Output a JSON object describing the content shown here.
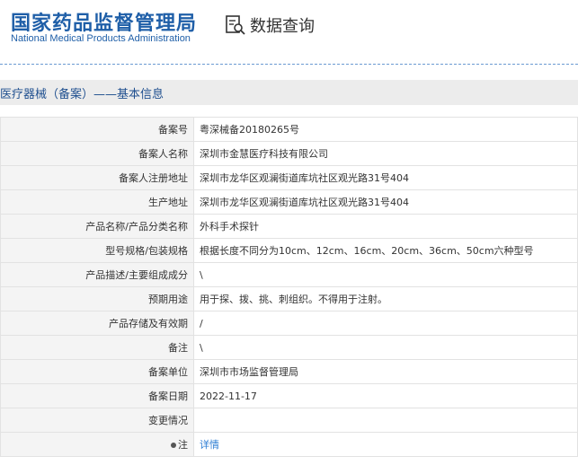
{
  "header": {
    "logo_cn": "国家药品监督管理局",
    "logo_en": "National Medical Products Administration",
    "search_label": "数据查询"
  },
  "section": {
    "title": "医疗器械（备案）——基本信息"
  },
  "rows": [
    {
      "label": "备案号",
      "value": "粤深械备20180265号"
    },
    {
      "label": "备案人名称",
      "value": "深圳市金慧医疗科技有限公司"
    },
    {
      "label": "备案人注册地址",
      "value": "深圳市龙华区观澜街道库坑社区观光路31号404"
    },
    {
      "label": "生产地址",
      "value": "深圳市龙华区观澜街道库坑社区观光路31号404"
    },
    {
      "label": "产品名称/产品分类名称",
      "value": "外科手术探针"
    },
    {
      "label": "型号规格/包装规格",
      "value": "根据长度不同分为10cm、12cm、16cm、20cm、36cm、50cm六种型号"
    },
    {
      "label": "产品描述/主要组成成分",
      "value": "\\"
    },
    {
      "label": "预期用途",
      "value": "用于探、拨、挑、刺组织。不得用于注射。"
    },
    {
      "label": "产品存储及有效期",
      "value": "/"
    },
    {
      "label": "备注",
      "value": "\\"
    },
    {
      "label": "备案单位",
      "value": "深圳市市场监督管理局"
    },
    {
      "label": "备案日期",
      "value": "2022-11-17"
    },
    {
      "label": "变更情况",
      "value": ""
    },
    {
      "label": "注",
      "value": "详情"
    }
  ],
  "colors": {
    "brand": "#1f5fa8",
    "link": "#2b7cd3",
    "label_bg": "#f4f4f4"
  }
}
